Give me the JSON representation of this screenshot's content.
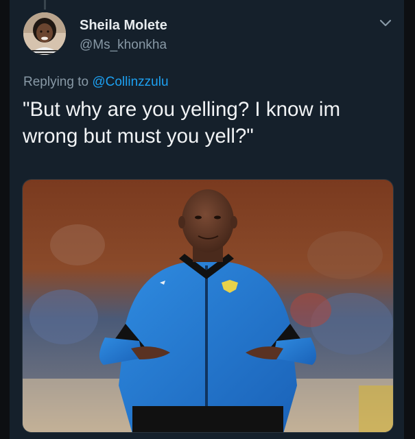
{
  "tweet": {
    "author": {
      "display_name": "Sheila Molete",
      "handle": "@Ms_khonkha"
    },
    "reply_prefix": "Replying to",
    "reply_to": "@Collinzzulu",
    "text": "\"But why are you yelling? I know im wrong but must you yell?\"",
    "menu_icon": "chevron-down-icon"
  },
  "colors": {
    "background": "#15202b",
    "text": "#f1f3f5",
    "secondary": "#8899a6",
    "accent": "#1da1f2"
  }
}
